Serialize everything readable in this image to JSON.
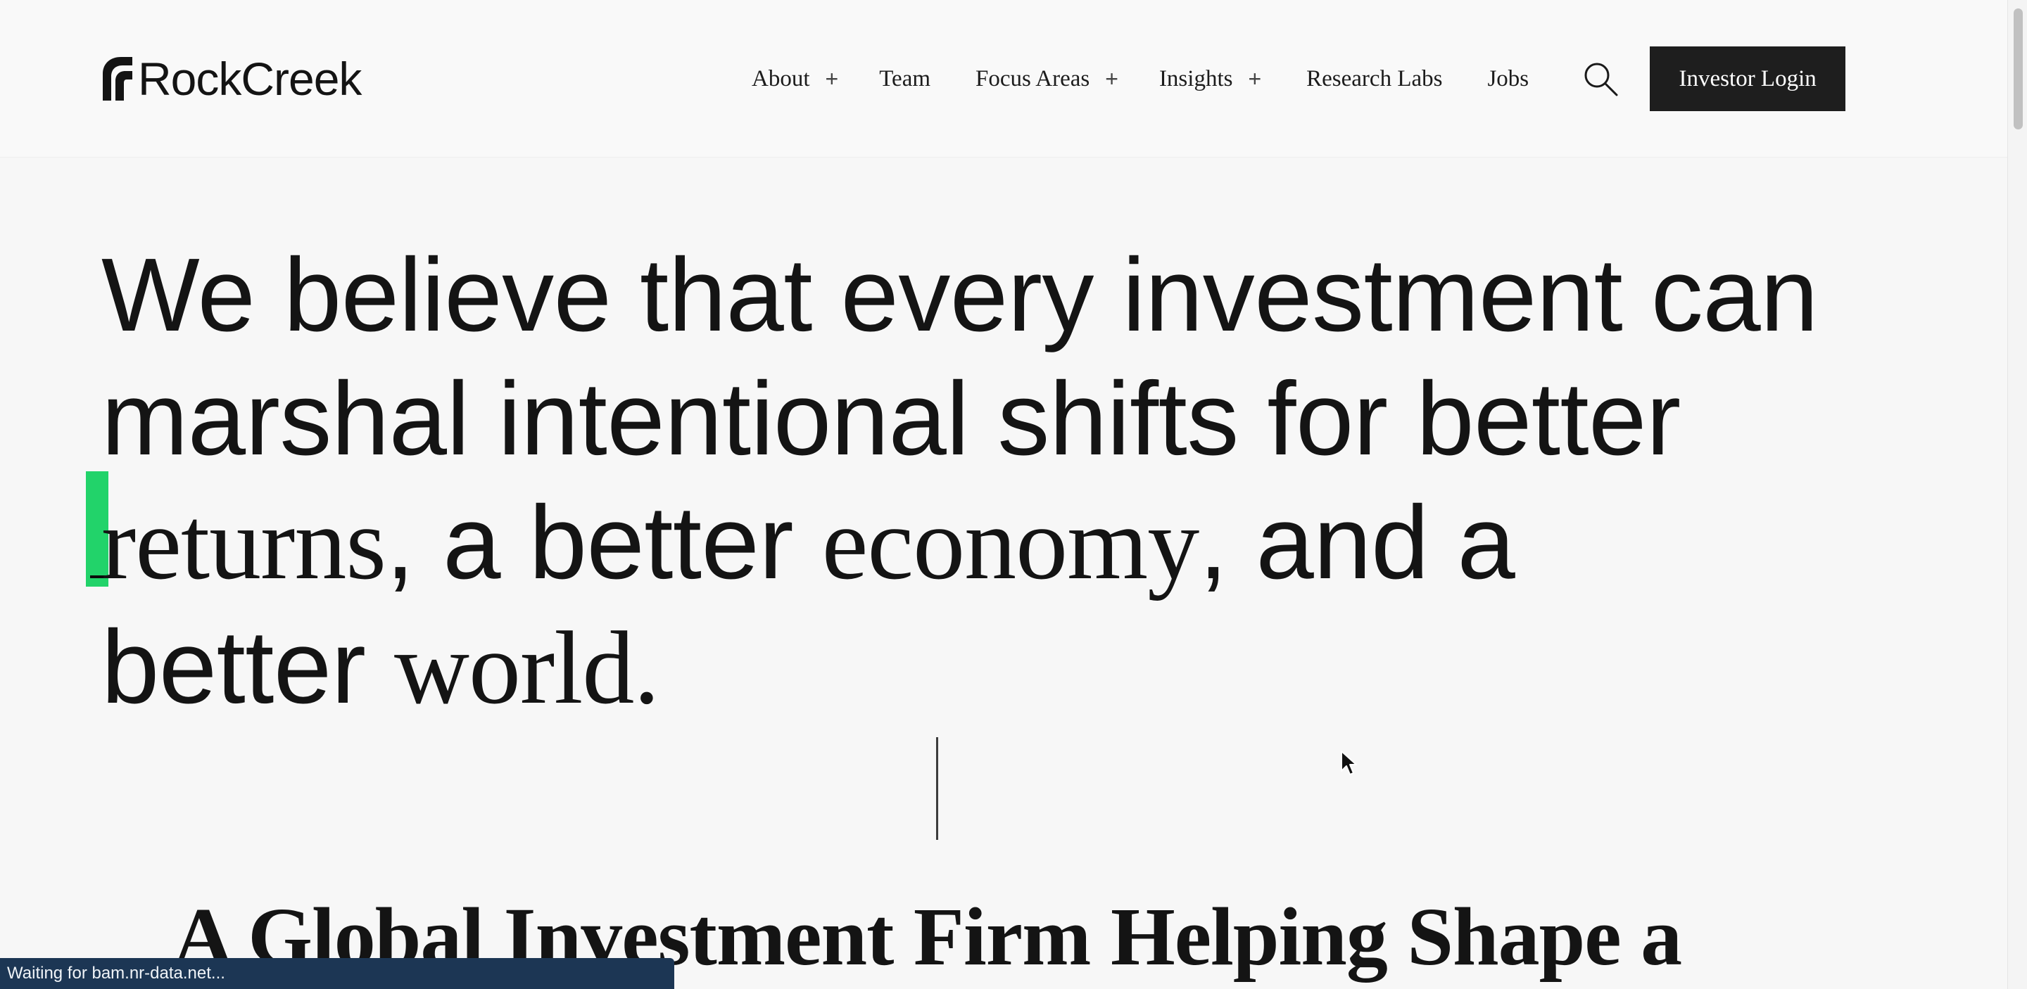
{
  "header": {
    "logo_text": "RockCreek",
    "nav": {
      "about": "About",
      "team": "Team",
      "focus_areas": "Focus Areas",
      "insights": "Insights",
      "research_labs": "Research Labs",
      "jobs": "Jobs",
      "expand_symbol": "+"
    },
    "login_label": "Investor Login"
  },
  "hero": {
    "line1": "We believe that every investment can",
    "line2": "marshal intentional shifts for better",
    "line3_serif_a": "returns",
    "line3_sans_a": ", a better ",
    "line3_serif_b": "economy",
    "line3_sans_b": ", and a",
    "line4_sans": "better ",
    "line4_serif": "world."
  },
  "section": {
    "title": "A Global Investment Firm Helping Shape a"
  },
  "status_bar": {
    "text": "Waiting for bam.nr-data.net..."
  },
  "colors": {
    "background": "#f7f7f7",
    "text": "#141414",
    "button_bg": "#1e1e1e",
    "accent_green": "#22d36a",
    "status_bar_bg": "#1c3654"
  },
  "icons": {
    "logo_mark": "rockcreek-logo-mark",
    "search": "search-icon",
    "pointer": "mouse-pointer-icon"
  }
}
